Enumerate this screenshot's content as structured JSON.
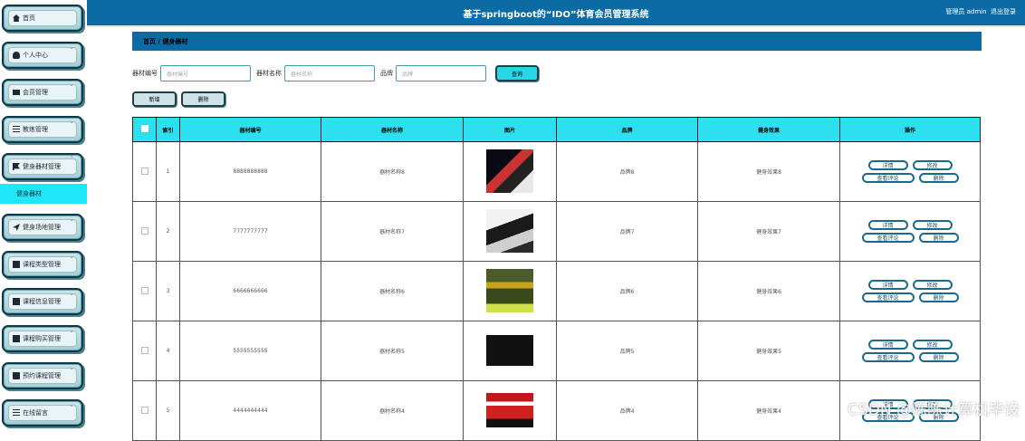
{
  "header": {
    "title": "基于springboot的“IDO”体育会员管理系统",
    "user_text": "管理员 admin",
    "logout": "退出登录"
  },
  "sidebar": {
    "items": [
      {
        "label": "首页",
        "icon": "home-icon",
        "chevron": false
      },
      {
        "label": "个人中心",
        "icon": "user-icon",
        "chevron": true
      },
      {
        "label": "会员管理",
        "icon": "monitor-icon",
        "chevron": true
      },
      {
        "label": "教练管理",
        "icon": "list-icon",
        "chevron": true
      },
      {
        "label": "健身器材管理",
        "icon": "flag-icon",
        "chevron": true,
        "expanded": true
      },
      {
        "label": "健身场地管理",
        "icon": "plane-icon",
        "chevron": true
      },
      {
        "label": "课程类型管理",
        "icon": "grid-icon",
        "chevron": true
      },
      {
        "label": "课程信息管理",
        "icon": "grid-icon",
        "chevron": true
      },
      {
        "label": "课程购买管理",
        "icon": "table-icon",
        "chevron": true
      },
      {
        "label": "预约课程管理",
        "icon": "bag-icon",
        "chevron": true
      },
      {
        "label": "在线留言",
        "icon": "sliders-icon",
        "chevron": true
      }
    ],
    "active_sub": "健身器材"
  },
  "breadcrumb": {
    "home": "首页",
    "separator": "/",
    "current": "健身器材"
  },
  "search": {
    "fields": [
      {
        "label": "器材编号",
        "placeholder": "器材编号"
      },
      {
        "label": "器材名称",
        "placeholder": "器材名称"
      },
      {
        "label": "品牌",
        "placeholder": "品牌"
      }
    ],
    "query_label": "查询"
  },
  "actions": {
    "add": "新增",
    "delete": "删除"
  },
  "table": {
    "headers": [
      "",
      "索引",
      "器材编号",
      "器材名称",
      "图片",
      "品牌",
      "健身效果",
      "操作"
    ],
    "rows": [
      {
        "index": "1",
        "code": "8888888888",
        "name": "器材名称8",
        "brand": "品牌8",
        "effect": "健身效果8",
        "img": "sport-photo-1"
      },
      {
        "index": "2",
        "code": "7777777777",
        "name": "器材名称7",
        "brand": "品牌7",
        "effect": "健身效果7",
        "img": "exercise-bike-photo"
      },
      {
        "index": "3",
        "code": "6666666666",
        "name": "器材名称6",
        "brand": "品牌6",
        "effect": "健身效果6",
        "img": "outdoor-photo"
      },
      {
        "index": "4",
        "code": "5555555555",
        "name": "器材名称5",
        "brand": "品牌5",
        "effect": "健身效果5",
        "img": "gym-machine-photo"
      },
      {
        "index": "5",
        "code": "4444444444",
        "name": "器材名称4",
        "brand": "品牌4",
        "effect": "健身效果4",
        "img": "red-machine-photo"
      }
    ],
    "op_labels": {
      "detail": "详情",
      "edit": "修改",
      "reviews": "查看评论",
      "delete": "删除"
    }
  },
  "watermark": "CSDN @陈陈计算机毕设"
}
